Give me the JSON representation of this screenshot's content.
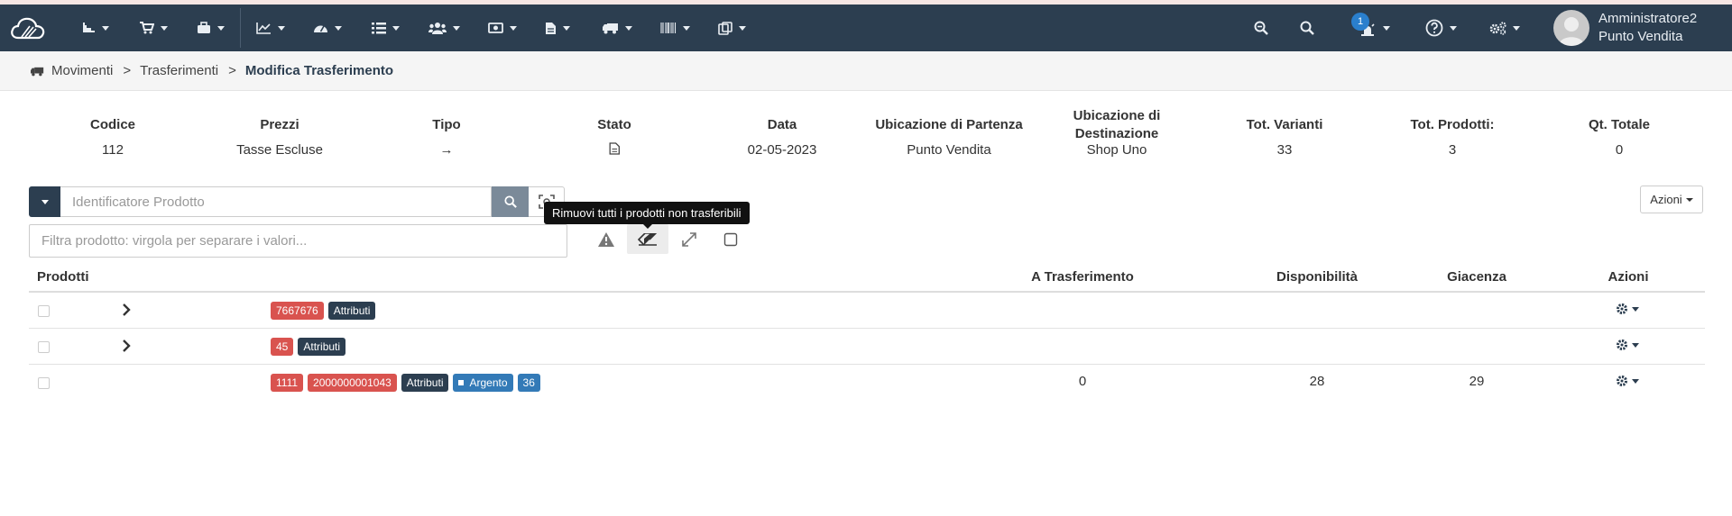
{
  "navbar": {
    "menus": [
      {
        "icon": "inventory-icon"
      },
      {
        "icon": "cart-icon"
      },
      {
        "icon": "briefcase-icon"
      },
      {
        "icon": "line-chart-icon"
      },
      {
        "icon": "dashboard-icon"
      },
      {
        "icon": "list-icon"
      },
      {
        "icon": "users-icon"
      },
      {
        "icon": "money-icon"
      },
      {
        "icon": "document-icon"
      },
      {
        "icon": "truck-icon"
      },
      {
        "icon": "barcode-icon"
      },
      {
        "icon": "clipboard-icon"
      }
    ],
    "notifications_count": "1",
    "user": {
      "name": "Amministratore2",
      "location": "Punto Vendita"
    },
    "colors": {
      "bar": "#2c3e50",
      "badge": "#2a7fcd"
    }
  },
  "breadcrumb": {
    "items": [
      "Movimenti",
      "Trasferimenti"
    ],
    "active": "Modifica Trasferimento",
    "separator": ">"
  },
  "summary": {
    "codice": {
      "label": "Codice",
      "value": "112"
    },
    "prezzi": {
      "label": "Prezzi",
      "value": "Tasse Escluse"
    },
    "tipo": {
      "label": "Tipo",
      "value": "→"
    },
    "stato": {
      "label": "Stato",
      "icon": "document-icon"
    },
    "data": {
      "label": "Data",
      "value": "02-05-2023"
    },
    "partenza": {
      "label": "Ubicazione di Partenza",
      "value": "Punto Vendita"
    },
    "destinazione": {
      "label_line1": "Ubicazione di",
      "label_line2": "Destinazione",
      "value": "Shop Uno"
    },
    "varianti": {
      "label": "Tot. Varianti",
      "value": "33"
    },
    "prodotti": {
      "label": "Tot. Prodotti:",
      "value": "3"
    },
    "qt_totale": {
      "label": "Qt. Totale",
      "value": "0"
    }
  },
  "search": {
    "placeholder": "Identificatore Prodotto"
  },
  "filter": {
    "placeholder": "Filtra prodotto: virgola per separare i valori..."
  },
  "tooltip": "Rimuovi tutti i prodotti non trasferibili",
  "azioni_button": "Azioni",
  "table": {
    "columns": {
      "prodotti": "Prodotti",
      "a_trasferimento": "A Trasferimento",
      "disponibilita": "Disponibilità",
      "giacenza": "Giacenza",
      "azioni": "Azioni"
    },
    "rows": [
      {
        "tags": [
          {
            "text": "7667676",
            "color": "red"
          },
          {
            "text": "Attributi",
            "color": "dark"
          }
        ],
        "a_trasferimento": "",
        "disponibilita": "",
        "giacenza": "",
        "expandable": true
      },
      {
        "tags": [
          {
            "text": "45",
            "color": "red"
          },
          {
            "text": "Attributi",
            "color": "dark"
          }
        ],
        "a_trasferimento": "",
        "disponibilita": "",
        "giacenza": "",
        "expandable": true
      },
      {
        "tags": [
          {
            "text": "1111",
            "color": "red"
          },
          {
            "text": "2000000001043",
            "color": "red"
          },
          {
            "text": "Attributi",
            "color": "dark"
          },
          {
            "text": "Argento",
            "color": "blue"
          },
          {
            "text": "36",
            "color": "blue"
          }
        ],
        "a_trasferimento": "0",
        "disponibilita": "28",
        "giacenza": "29",
        "expandable": false
      }
    ]
  }
}
